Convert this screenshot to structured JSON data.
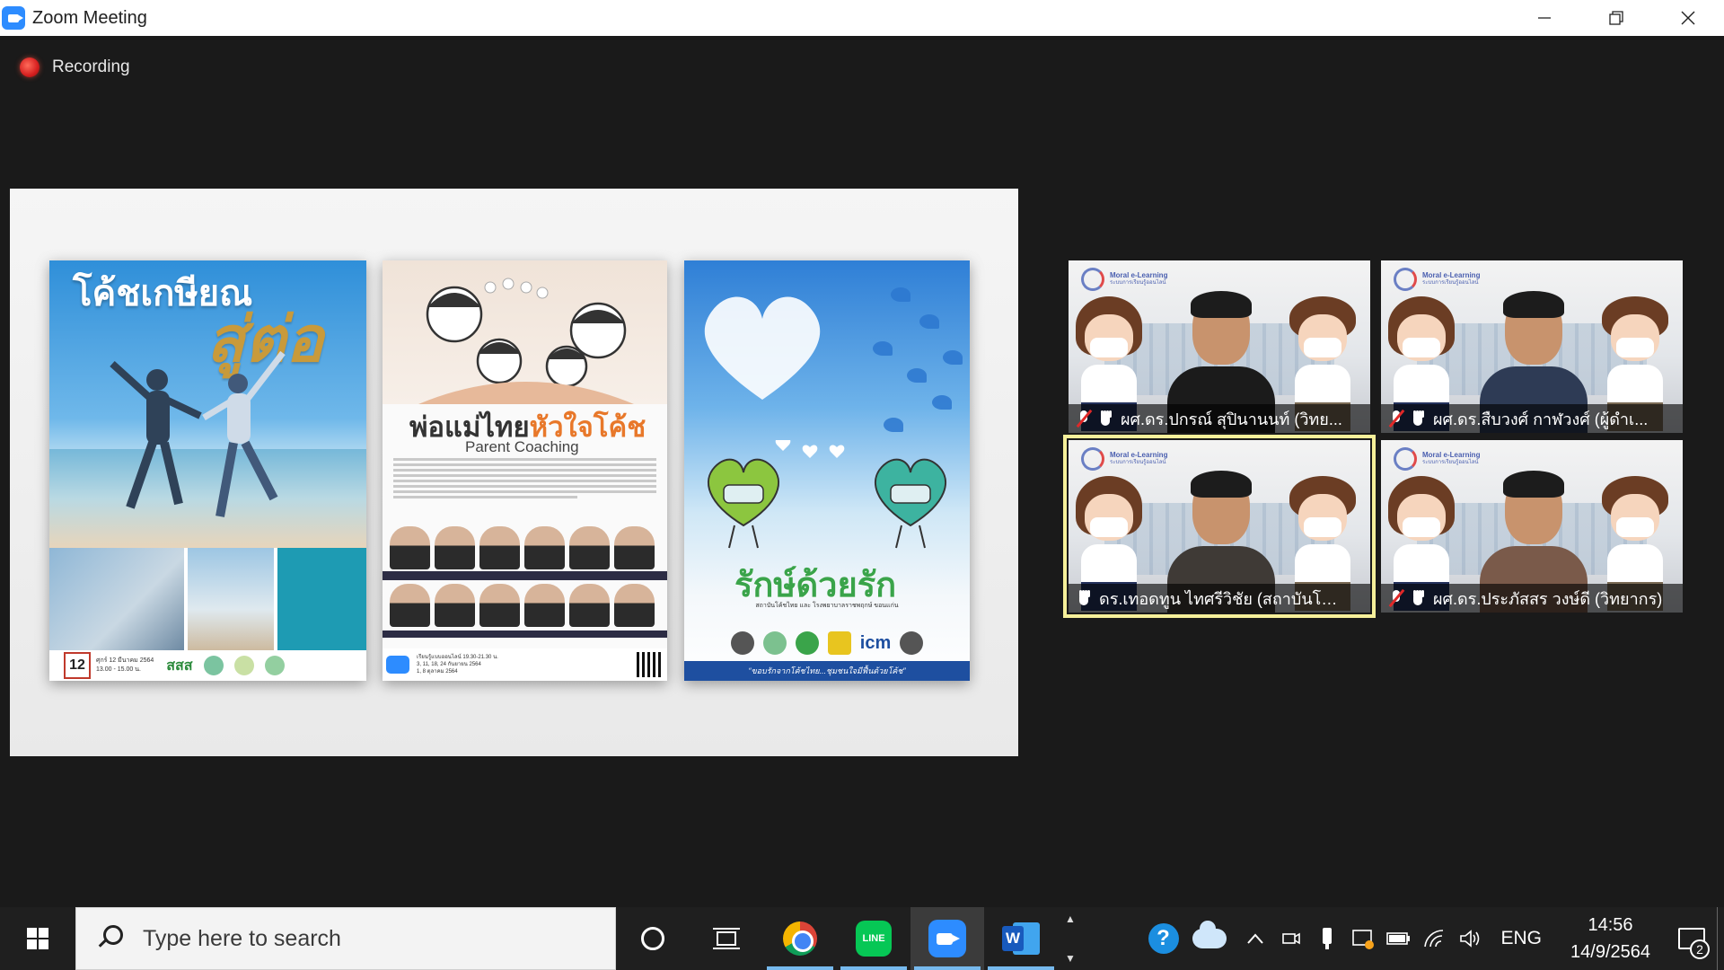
{
  "window": {
    "title": "Zoom Meeting",
    "minimize_icon": "minimize-icon",
    "restore_icon": "restore-icon",
    "close_icon": "close-icon"
  },
  "meeting": {
    "recording_label": "Recording"
  },
  "shared_screen": {
    "posters": [
      {
        "title_line1": "โค้ชเกษียณ",
        "title_line2": "สู่ต่อ",
        "date_day": "12",
        "date_text": "ศุกร์ 12 มีนาคม 2564",
        "time_text": "13.00 - 15.00 น.",
        "logo_text": "สสส"
      },
      {
        "title_black": "พ่อแม่ไทย",
        "title_orange": "หัวใจโค้ช",
        "subtitle": "Parent Coaching",
        "footer_text": "เรียนรู้แบบออนไลน์ 19.30-21.30 น.",
        "footer_dates1": "3, 11, 18, 24 กันยายน 2564",
        "footer_dates2": "1, 8 ตุลาคม 2564",
        "zoom_label": "zoom"
      },
      {
        "title": "รักษ์ด้วยรัก",
        "small_text": "สถาบันโค้ชไทย และ โรงพยาบาลราชพฤกษ์ ขอนแก่น",
        "strip_text": "“ขอบรักจากโค้ชไทย...ชุมชนใจมีฟื้นด้วยโค้ช”",
        "logo_text": "icm"
      }
    ]
  },
  "participants": [
    {
      "name": "ผศ.ดร.ปกรณ์ สุปินานนท์ (วิทย...",
      "muted": true,
      "active": false,
      "shirt": "#1b1b1b"
    },
    {
      "name": "ผศ.ดร.สืบวงศ์ กาฬวงศ์ (ผู้ดำเ...",
      "muted": true,
      "active": false,
      "shirt": "#2e3b55"
    },
    {
      "name": "ดร.เทอดทูน ไทศรีวิชัย (สถาบันโค้ชไ...",
      "muted": false,
      "active": true,
      "shirt": "#3f3a36"
    },
    {
      "name": "ผศ.ดร.ประภัสสร วงษ์ดี (วิทยากร)",
      "muted": true,
      "active": false,
      "shirt": "#7a5a4a"
    }
  ],
  "moral_logo": {
    "line1": "Moral e-Learning",
    "line2": "ระบบการเรียนรู้ออนไลน์"
  },
  "taskbar": {
    "search_placeholder": "Type here to search",
    "apps": [
      "cortana-icon",
      "task-view-icon",
      "chrome-icon",
      "line-icon",
      "zoom-icon",
      "word-icon"
    ],
    "line_label": "LINE",
    "word_label": "W",
    "tray": {
      "language": "ENG",
      "time": "14:56",
      "date": "14/9/2564",
      "notification_count": "2"
    }
  },
  "colors": {
    "zoom_blue": "#2d8cff",
    "active_speaker": "#f6f09a",
    "recording_red": "#d61f1f",
    "taskbar": "#1f1f1f"
  }
}
